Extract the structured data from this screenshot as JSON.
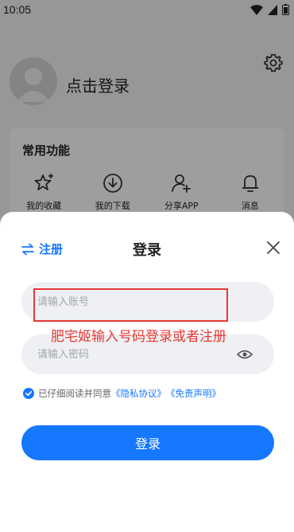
{
  "status_bar": {
    "time": "10:05"
  },
  "profile": {
    "login_prompt": "点击登录"
  },
  "functions": {
    "title": "常用功能",
    "items": [
      {
        "label": "我的收藏",
        "icon": "star-icon"
      },
      {
        "label": "我的下载",
        "icon": "download-icon"
      },
      {
        "label": "分享APP",
        "icon": "add-user-icon"
      },
      {
        "label": "消息",
        "icon": "bell-icon"
      }
    ]
  },
  "login_sheet": {
    "switch_label": "注册",
    "title": "登录",
    "account_placeholder": "请输入账号",
    "password_placeholder": "请输入密码",
    "annotation": "肥宅姬输入号码登录或者注册",
    "agreement": {
      "prefix": "已仔细阅读并同意",
      "privacy": "《隐私协议》",
      "disclaimer": "《免责声明》"
    },
    "submit_label": "登录"
  },
  "colors": {
    "accent": "#1677ff",
    "annotation": "#e53935"
  }
}
